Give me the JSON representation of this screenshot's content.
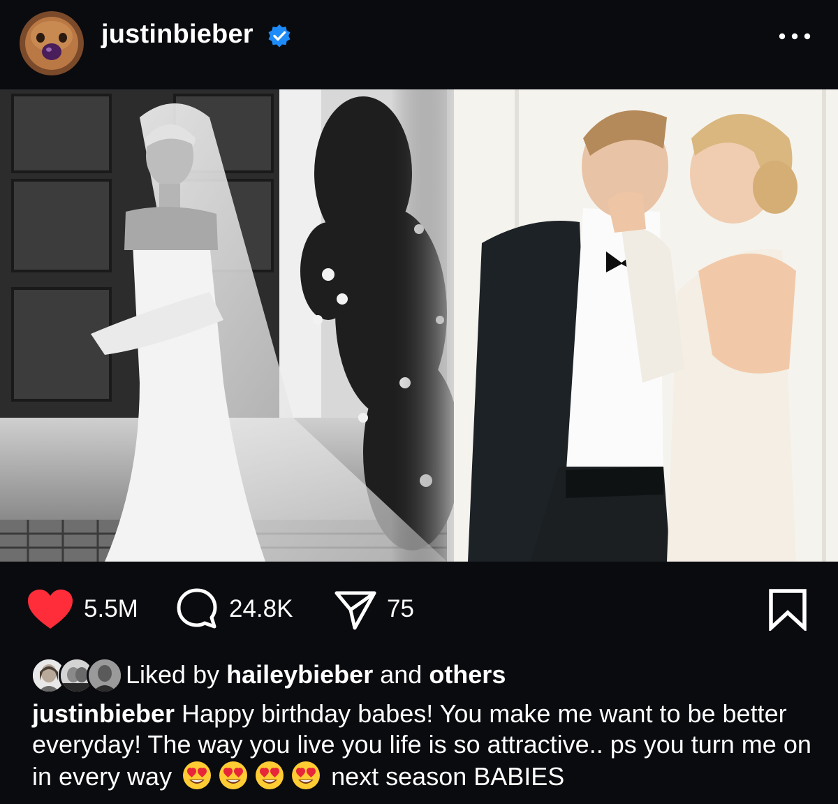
{
  "post": {
    "username": "justinbieber",
    "verified": true,
    "more_icon": "more-horizontal-icon"
  },
  "actions": {
    "likes": "5.5M",
    "comments": "24.8K",
    "shares": "75",
    "like_icon": "heart-icon",
    "comment_icon": "comment-bubble-icon",
    "share_icon": "paper-plane-icon",
    "save_icon": "bookmark-icon",
    "like_color": "#ff2d3a"
  },
  "liked_by": {
    "prefix": "Liked by",
    "user": "haileybieber",
    "and": "and",
    "others": "others"
  },
  "caption": {
    "user": "justinbieber",
    "text_before_emoji": "Happy birthday babes! You make me want to be better everyday! The way you live you life is so attractive.. ps you turn me on in every way",
    "emoji_count": 4,
    "emoji_name": "heart-eyes-emoji",
    "text_after_emoji": "next season BABIES"
  }
}
